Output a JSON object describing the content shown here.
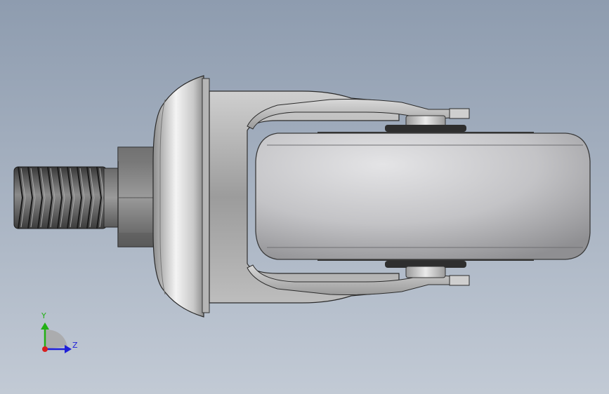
{
  "viewport": {
    "background_top": "#8e9caf",
    "background_bottom": "#c2cad5"
  },
  "model": {
    "name": "caster-wheel-icon",
    "parts": [
      "threaded-stem",
      "hex-nut",
      "mounting-cap",
      "fork-bracket",
      "wheel",
      "axle-bolt"
    ]
  },
  "triad": {
    "y_label": "Y",
    "z_label": "Z",
    "y_color": "#22b014",
    "z_color": "#1f1fd8",
    "x_color": "#d81f1f"
  }
}
